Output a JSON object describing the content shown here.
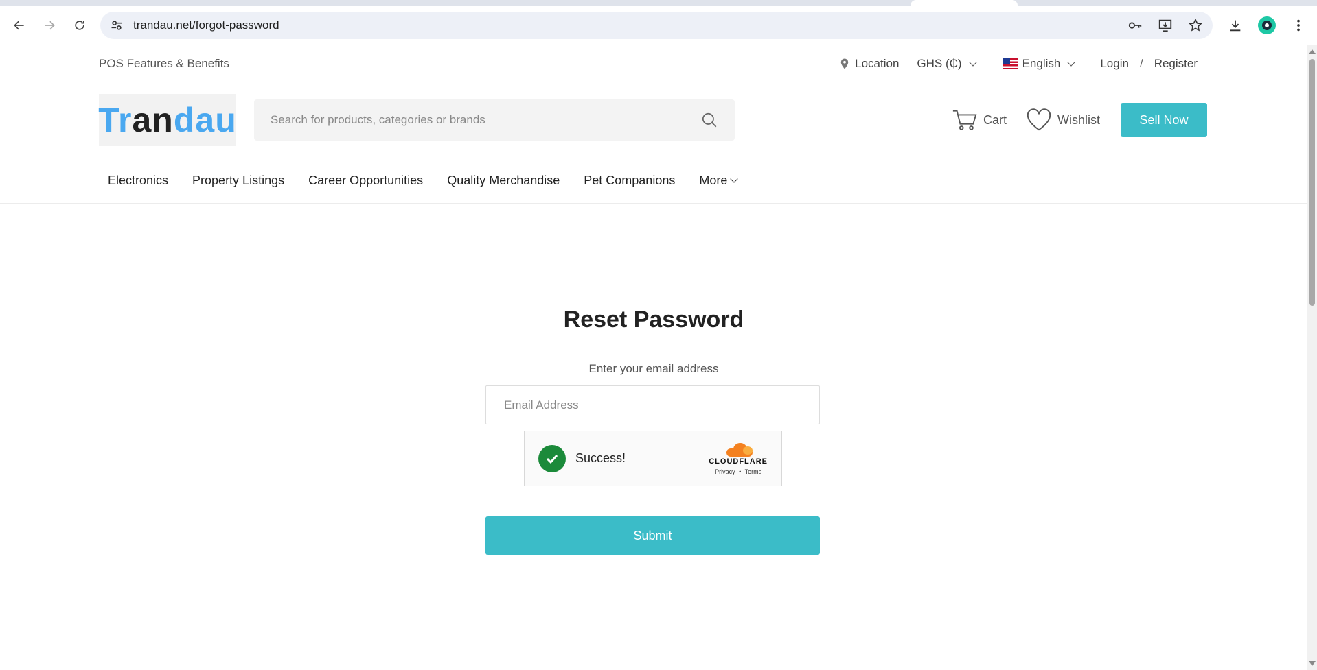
{
  "browser": {
    "url": "trandau.net/forgot-password"
  },
  "topbar": {
    "pos_link": "POS Features & Benefits",
    "location": "Location",
    "currency": "GHS (₵)",
    "language": "English",
    "login": "Login",
    "separator": "/",
    "register": "Register"
  },
  "header": {
    "logo_part1": "Tr",
    "logo_part2": "an",
    "logo_part3": "dau",
    "search_placeholder": "Search for products, categories or brands",
    "cart": "Cart",
    "wishlist": "Wishlist",
    "sell_now": "Sell Now"
  },
  "categories": [
    "Electronics",
    "Property Listings",
    "Career Opportunities",
    "Quality Merchandise",
    "Pet Companions",
    "More"
  ],
  "reset": {
    "title": "Reset Password",
    "subtitle": "Enter your email address",
    "email_placeholder": "Email Address",
    "captcha_status": "Success!",
    "captcha_brand": "CLOUDFLARE",
    "captcha_privacy": "Privacy",
    "captcha_dot": "•",
    "captcha_terms": "Terms",
    "submit": "Submit"
  },
  "colors": {
    "accent": "#3bbcc8",
    "logo_blue": "#4aa8f0",
    "success_green": "#1b8a3a",
    "cloudflare_orange": "#f48120"
  }
}
